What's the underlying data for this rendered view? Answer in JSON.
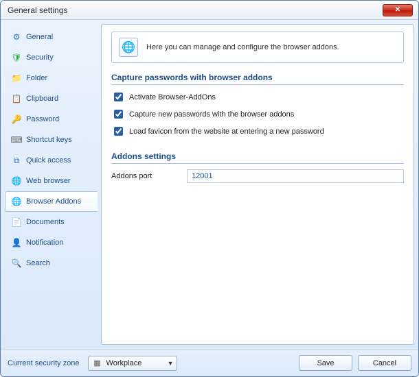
{
  "window": {
    "title": "General settings"
  },
  "sidebar": {
    "items": [
      {
        "label": "General",
        "icon": "⚙",
        "iconColor": "#2a6fbf"
      },
      {
        "label": "Security",
        "icon": "🛡",
        "iconColor": "#2fae3b"
      },
      {
        "label": "Folder",
        "icon": "📁",
        "iconColor": "#d9a436"
      },
      {
        "label": "Clipboard",
        "icon": "📋",
        "iconColor": "#b58a45"
      },
      {
        "label": "Password",
        "icon": "🔑",
        "iconColor": "#d9a436"
      },
      {
        "label": "Shortcut keys",
        "icon": "⌨",
        "iconColor": "#6b6b6b"
      },
      {
        "label": "Quick access",
        "icon": "⧉",
        "iconColor": "#2a6fbf"
      },
      {
        "label": "Web browser",
        "icon": "🌐",
        "iconColor": "#2a6fbf"
      },
      {
        "label": "Browser Addons",
        "icon": "🌐",
        "iconColor": "#2a6fbf",
        "selected": true
      },
      {
        "label": "Documents",
        "icon": "📄",
        "iconColor": "#6b8fbf"
      },
      {
        "label": "Notification",
        "icon": "👤",
        "iconColor": "#d97a2a"
      },
      {
        "label": "Search",
        "icon": "🔍",
        "iconColor": "#2a6fbf"
      }
    ]
  },
  "main": {
    "info": "Here you can manage and configure the browser addons.",
    "section1": {
      "title": "Capture passwords with browser addons",
      "check1": {
        "label": "Activate Browser-AddOns",
        "checked": true
      },
      "check2": {
        "label": "Capture new passwords with the browser addons",
        "checked": true
      },
      "check3": {
        "label": "Load favicon from the website at entering a new password",
        "checked": true
      }
    },
    "section2": {
      "title": "Addons settings",
      "port_label": "Addons port",
      "port_value": "12001"
    }
  },
  "footer": {
    "zone_label": "Current security zone",
    "zone_value": "Workplace",
    "save": "Save",
    "cancel": "Cancel"
  }
}
